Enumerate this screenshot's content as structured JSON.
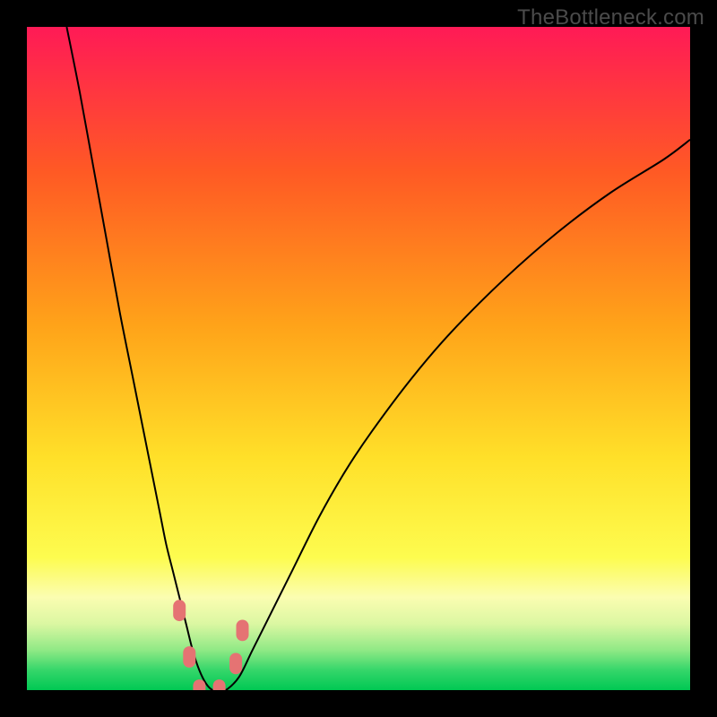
{
  "watermark": "TheBottleneck.com",
  "chart_data": {
    "type": "line",
    "title": "",
    "xlabel": "",
    "ylabel": "",
    "xlim": [
      0,
      100
    ],
    "ylim": [
      0,
      100
    ],
    "grid": false,
    "legend": false,
    "background": {
      "type": "vertical-gradient",
      "stops": [
        {
          "pos": 0.0,
          "color": "#ff1a56"
        },
        {
          "pos": 0.22,
          "color": "#ff5a24"
        },
        {
          "pos": 0.45,
          "color": "#ffa319"
        },
        {
          "pos": 0.65,
          "color": "#ffe029"
        },
        {
          "pos": 0.8,
          "color": "#fdfc4f"
        },
        {
          "pos": 0.86,
          "color": "#fbfdb1"
        },
        {
          "pos": 0.9,
          "color": "#dbf7a2"
        },
        {
          "pos": 0.94,
          "color": "#8fe985"
        },
        {
          "pos": 0.97,
          "color": "#35d66a"
        },
        {
          "pos": 1.0,
          "color": "#00c853"
        }
      ]
    },
    "series": [
      {
        "name": "bottleneck-curve",
        "color": "#000000",
        "width": 2,
        "x": [
          6,
          8,
          10,
          12,
          14,
          16,
          18,
          20,
          21,
          22,
          23,
          24,
          25,
          26,
          27,
          28,
          29,
          30,
          32,
          34,
          37,
          40,
          44,
          48,
          52,
          58,
          64,
          72,
          80,
          88,
          96,
          100
        ],
        "y": [
          100,
          90,
          79,
          68,
          57,
          47,
          37,
          27,
          22,
          18,
          14,
          10,
          6,
          3,
          1,
          0,
          0,
          0,
          2,
          6,
          12,
          18,
          26,
          33,
          39,
          47,
          54,
          62,
          69,
          75,
          80,
          83
        ]
      }
    ],
    "markers": [
      {
        "name": "left-dot-1",
        "x": 23.0,
        "y": 12,
        "color": "#e57373",
        "r": 7
      },
      {
        "name": "left-dot-2",
        "x": 24.5,
        "y": 5,
        "color": "#e57373",
        "r": 7
      },
      {
        "name": "bottom-dot-1",
        "x": 26.0,
        "y": 0,
        "color": "#e57373",
        "r": 7
      },
      {
        "name": "bottom-dot-2",
        "x": 29.0,
        "y": 0,
        "color": "#e57373",
        "r": 7
      },
      {
        "name": "right-dot-1",
        "x": 31.5,
        "y": 4,
        "color": "#e57373",
        "r": 7
      },
      {
        "name": "right-dot-2",
        "x": 32.5,
        "y": 9,
        "color": "#e57373",
        "r": 7
      }
    ]
  }
}
